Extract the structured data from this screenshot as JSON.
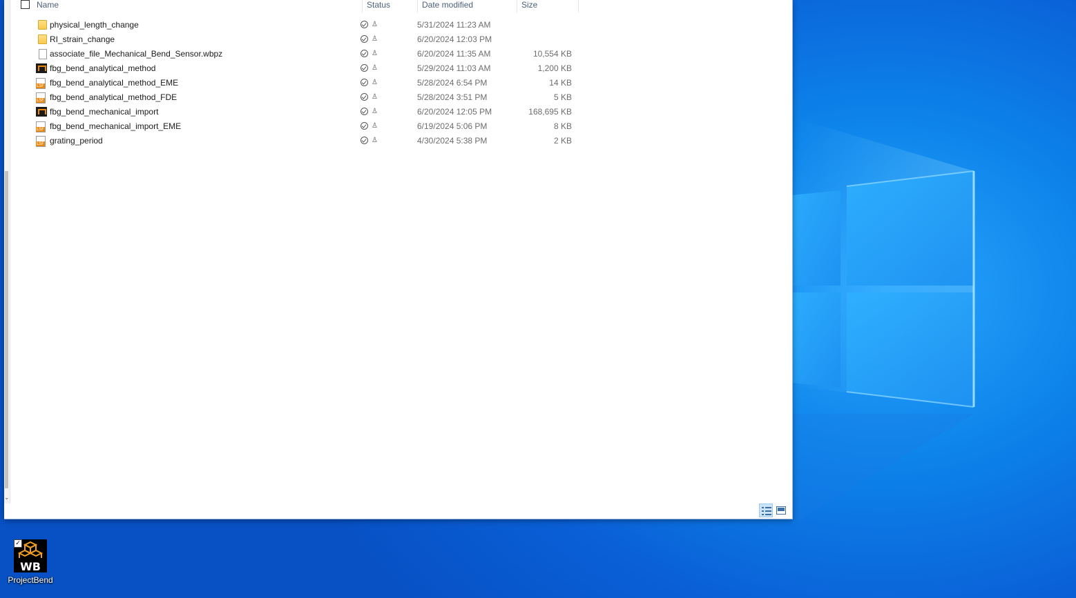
{
  "explorer": {
    "columns": {
      "name": "Name",
      "status": "Status",
      "date_modified": "Date modified",
      "size": "Size"
    },
    "files": [
      {
        "name": "physical_length_change",
        "icon": "folder-icon",
        "date": "5/31/2024 11:23 AM",
        "size": ""
      },
      {
        "name": "RI_strain_change",
        "icon": "folder-icon",
        "date": "6/20/2024 12:03 PM",
        "size": ""
      },
      {
        "name": "associate_file_Mechanical_Bend_Sensor.wbpz",
        "icon": "file-icon",
        "date": "6/20/2024 11:35 AM",
        "size": "10,554 KB"
      },
      {
        "name": "fbg_bend_analytical_method",
        "icon": "fsp-project-icon",
        "date": "5/29/2024 11:03 AM",
        "size": "1,200 KB"
      },
      {
        "name": "fbg_bend_analytical_method_EME",
        "icon": "lsf-script-icon",
        "date": "5/28/2024 6:54 PM",
        "size": "14 KB"
      },
      {
        "name": "fbg_bend_analytical_method_FDE",
        "icon": "lsf-script-icon",
        "date": "5/28/2024 3:51 PM",
        "size": "5 KB"
      },
      {
        "name": "fbg_bend_mechanical_import",
        "icon": "fsp-project-icon",
        "date": "6/20/2024 12:05 PM",
        "size": "168,695 KB"
      },
      {
        "name": "fbg_bend_mechanical_import_EME",
        "icon": "lsf-script-icon",
        "date": "6/19/2024 5:06 PM",
        "size": "8 KB"
      },
      {
        "name": "grating_period",
        "icon": "lsf-script-icon",
        "date": "4/30/2024 5:38 PM",
        "size": "2 KB"
      }
    ],
    "status_icons": [
      "sync-check-icon",
      "shared-person-icon"
    ],
    "view_buttons": [
      "details-view-icon",
      "large-icons-view-icon"
    ]
  },
  "desktop": {
    "icon_label": "ProjectBend",
    "icon_badge": "WB",
    "icon_name": "workbench-project-icon"
  },
  "colors": {
    "desktop_blue": "#0a64d8",
    "header_text": "#4c607a",
    "secondary_text": "#6d6d6d",
    "selected_view": "#cce4f7"
  }
}
